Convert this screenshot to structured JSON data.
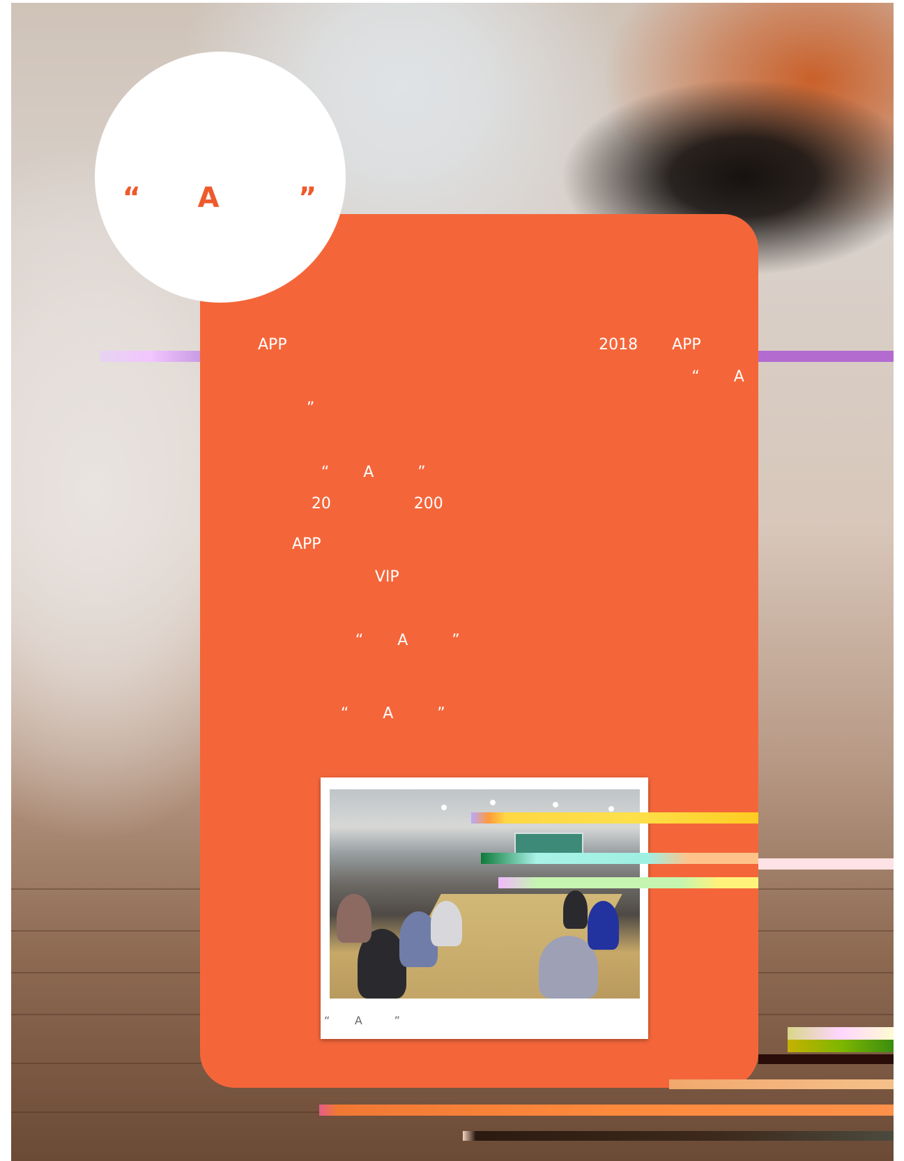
{
  "header": {
    "title": "“     A       ”"
  },
  "body": {
    "lines": [
      "APP                                                                2018       APP",
      "                                                                                         “       A",
      "          ”",
      "             “       A         ”",
      "           20                 200",
      "       APP",
      "                        VIP",
      "                    “       A         ”",
      "                 “       A         ”"
    ]
  },
  "photo": {
    "caption": "“       A         ”"
  }
}
